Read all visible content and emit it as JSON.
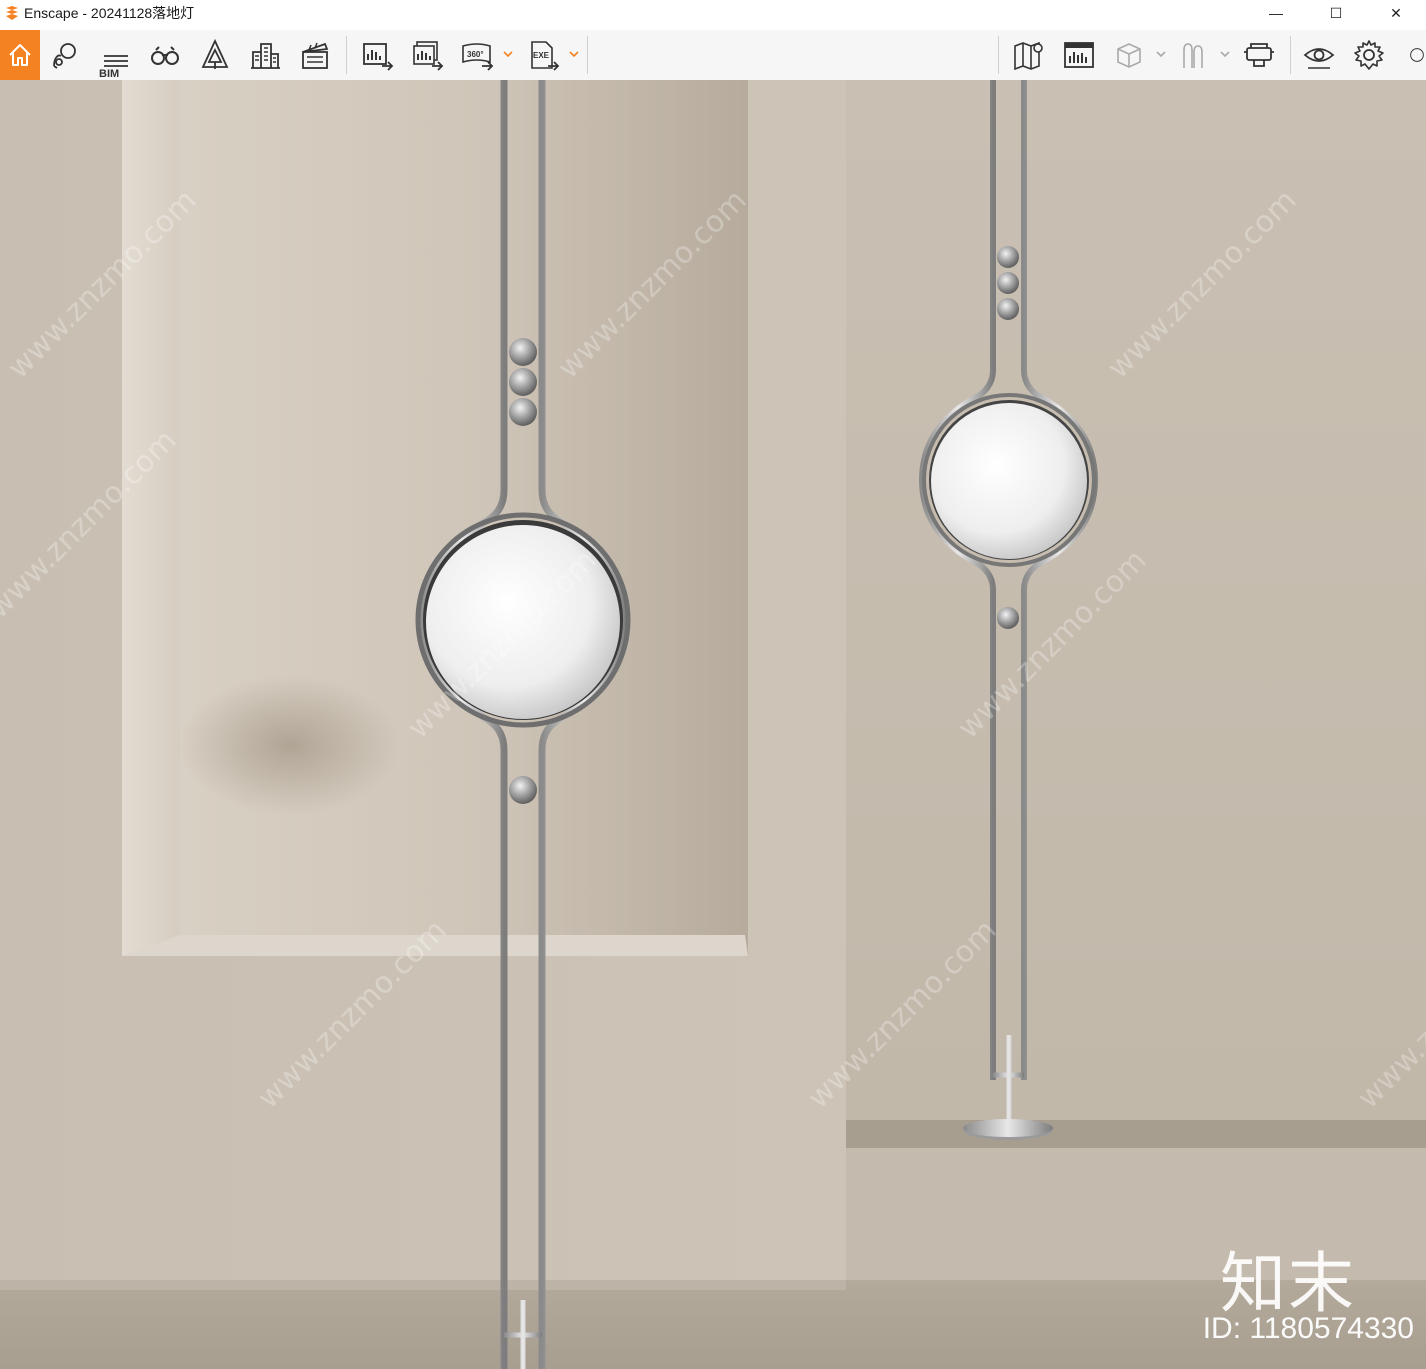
{
  "window": {
    "app_name": "Enscape",
    "title": "Enscape - 20241128落地灯",
    "minimize": "—",
    "maximize": "☐",
    "close": "✕"
  },
  "toolbar": {
    "bim_label": "BIM",
    "accent_color": "#f58220",
    "left_tools": [
      {
        "name": "home",
        "icon": "home-icon",
        "active": true
      },
      {
        "name": "views",
        "icon": "location-pin-icon"
      },
      {
        "name": "bim",
        "icon": "bim-list-icon"
      },
      {
        "name": "binoculars",
        "icon": "binoculars-icon"
      },
      {
        "name": "atmosphere",
        "icon": "tree-icon"
      },
      {
        "name": "buildings",
        "icon": "buildings-icon"
      },
      {
        "name": "video",
        "icon": "clapperboard-icon"
      },
      {
        "name": "screenshot",
        "icon": "export-image-icon"
      },
      {
        "name": "batch-render",
        "icon": "batch-render-icon"
      },
      {
        "name": "panorama",
        "icon": "360-icon",
        "label": "360°"
      },
      {
        "name": "standalone",
        "icon": "exe-export-icon",
        "label": "EXE"
      }
    ],
    "right_tools": [
      {
        "name": "map",
        "icon": "map-icon"
      },
      {
        "name": "site-context",
        "icon": "dashboard-icon"
      },
      {
        "name": "material",
        "icon": "cube-icon"
      },
      {
        "name": "assets",
        "icon": "figures-icon"
      },
      {
        "name": "vr",
        "icon": "vr-headset-icon"
      },
      {
        "name": "visual-settings",
        "icon": "eye-icon"
      },
      {
        "name": "settings",
        "icon": "gear-icon"
      }
    ]
  },
  "viewport": {
    "watermark_url": "www.znzmo.com",
    "watermark_brand": "知末",
    "watermark_id": "ID: 1180574330"
  }
}
